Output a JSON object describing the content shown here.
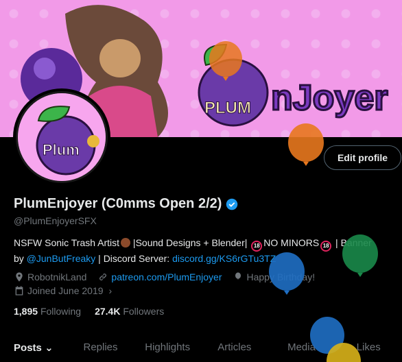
{
  "header": {
    "banner_text": "PLUM nJoyer"
  },
  "profile": {
    "name": "PlumEnjoyer (C0mms Open 2/2)",
    "handle": "@PlumEnjoyerSFX",
    "avatar_text": "Plum",
    "edit_label": "Edit profile",
    "bio_line1_a": "NSFW Sonic Trash Artist",
    "bio_line1_b": " |Sound Designs + Blender| ",
    "bio_18": "18",
    "bio_line1_c": "NO MINORS",
    "bio_line1_d": " | Banner",
    "bio_line2_a": "by ",
    "bio_mention": "@JunButFreaky",
    "bio_line2_b": " | Discord Server: ",
    "bio_discord": "discord.gg/KS6rGTu3TZ"
  },
  "meta": {
    "location": "RobotnikLand",
    "website": "patreon.com/PlumEnjoyer",
    "birthday": "Happy Birthday!",
    "joined": "Joined June 2019"
  },
  "stats": {
    "following_count": "1,895",
    "following_label": "Following",
    "followers_count": "27.4K",
    "followers_label": "Followers"
  },
  "tabs": [
    "Posts",
    "Replies",
    "Highlights",
    "Articles",
    "Media",
    "Likes"
  ],
  "colors": {
    "accent": "#1d9bf0",
    "banner_pink": "#f29ae8",
    "balloon_orange": "#e8781e",
    "balloon_green": "#1a8a4a",
    "balloon_blue": "#1f6fc4",
    "balloon_yellow": "#d9b21a"
  }
}
